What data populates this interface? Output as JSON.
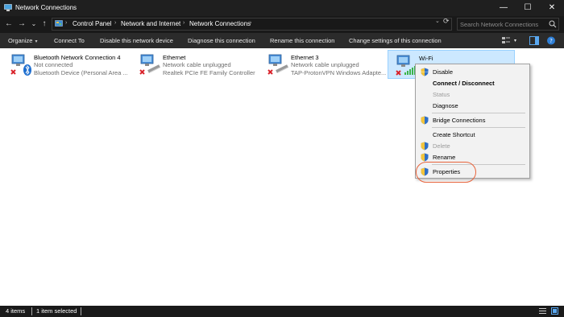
{
  "window": {
    "title": "Network Connections",
    "minimize_glyph": "—",
    "maximize_glyph": "☐",
    "close_glyph": "✕"
  },
  "address_bar": {
    "back_glyph": "←",
    "forward_glyph": "→",
    "recent_glyph": "⌄",
    "up_glyph": "↑",
    "separator_glyph": "›",
    "breadcrumbs": [
      "Control Panel",
      "Network and Internet",
      "Network Connections"
    ],
    "dropdown_glyph": "⌄",
    "refresh_glyph": "⟳",
    "search_placeholder": "Search Network Connections"
  },
  "command_bar": {
    "organize": "Organize",
    "organize_caret": "▾",
    "connect_to": "Connect To",
    "disable_device": "Disable this network device",
    "diagnose": "Diagnose this connection",
    "rename": "Rename this connection",
    "change_settings": "Change settings of this connection",
    "view_caret": "▾"
  },
  "adapters": [
    {
      "name": "Bluetooth Network Connection 4",
      "status": "Not connected",
      "device": "Bluetooth Device (Personal Area ...",
      "icon": "bluetooth-adapter-icon",
      "selected": false
    },
    {
      "name": "Ethernet",
      "status": "Network cable unplugged",
      "device": "Realtek PCIe FE Family Controller",
      "icon": "ethernet-adapter-icon",
      "selected": false
    },
    {
      "name": "Ethernet 3",
      "status": "Network cable unplugged",
      "device": "TAP-ProtonVPN Windows Adapte...",
      "icon": "ethernet-adapter-icon",
      "selected": false
    },
    {
      "name": "Wi-Fi",
      "status": "",
      "device": "",
      "icon": "wifi-adapter-icon",
      "selected": true
    }
  ],
  "context_menu": {
    "disable": "Disable",
    "connect_disconnect": "Connect / Disconnect",
    "status": "Status",
    "diagnose": "Diagnose",
    "bridge": "Bridge Connections",
    "create_shortcut": "Create Shortcut",
    "delete": "Delete",
    "rename": "Rename",
    "properties": "Properties"
  },
  "status_bar": {
    "items_count": "4 items",
    "selection": "1 item selected"
  },
  "colors": {
    "accent_ring": "#e8643c",
    "selection_bg": "#cce8ff",
    "titlebar_bg": "#1f1f1f"
  }
}
